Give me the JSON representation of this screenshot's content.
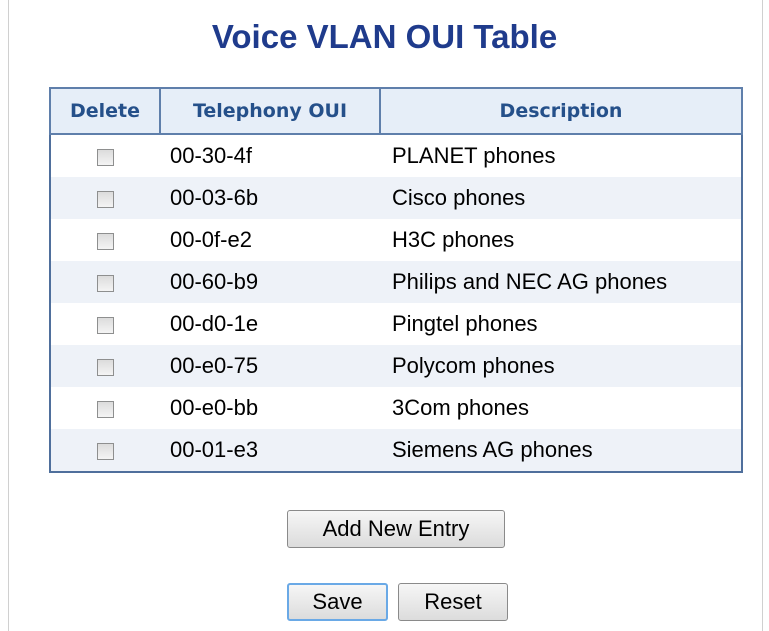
{
  "page": {
    "title": "Voice VLAN OUI Table"
  },
  "table": {
    "headers": {
      "delete": "Delete",
      "oui": "Telephony OUI",
      "description": "Description"
    },
    "rows": [
      {
        "delete": false,
        "oui": "00-30-4f",
        "description": "PLANET phones"
      },
      {
        "delete": false,
        "oui": "00-03-6b",
        "description": "Cisco phones"
      },
      {
        "delete": false,
        "oui": "00-0f-e2",
        "description": "H3C phones"
      },
      {
        "delete": false,
        "oui": "00-60-b9",
        "description": "Philips and NEC AG phones"
      },
      {
        "delete": false,
        "oui": "00-d0-1e",
        "description": "Pingtel phones"
      },
      {
        "delete": false,
        "oui": "00-e0-75",
        "description": "Polycom phones"
      },
      {
        "delete": false,
        "oui": "00-e0-bb",
        "description": "3Com phones"
      },
      {
        "delete": false,
        "oui": "00-01-e3",
        "description": "Siemens AG phones"
      }
    ]
  },
  "buttons": {
    "add_new_entry": "Add New Entry",
    "save": "Save",
    "reset": "Reset"
  },
  "colors": {
    "title": "#1f3b8c",
    "header_bg": "#e6eef8",
    "header_text": "#25508a",
    "table_border": "#4f6f9c",
    "row_alt_bg": "#eef2f8"
  }
}
